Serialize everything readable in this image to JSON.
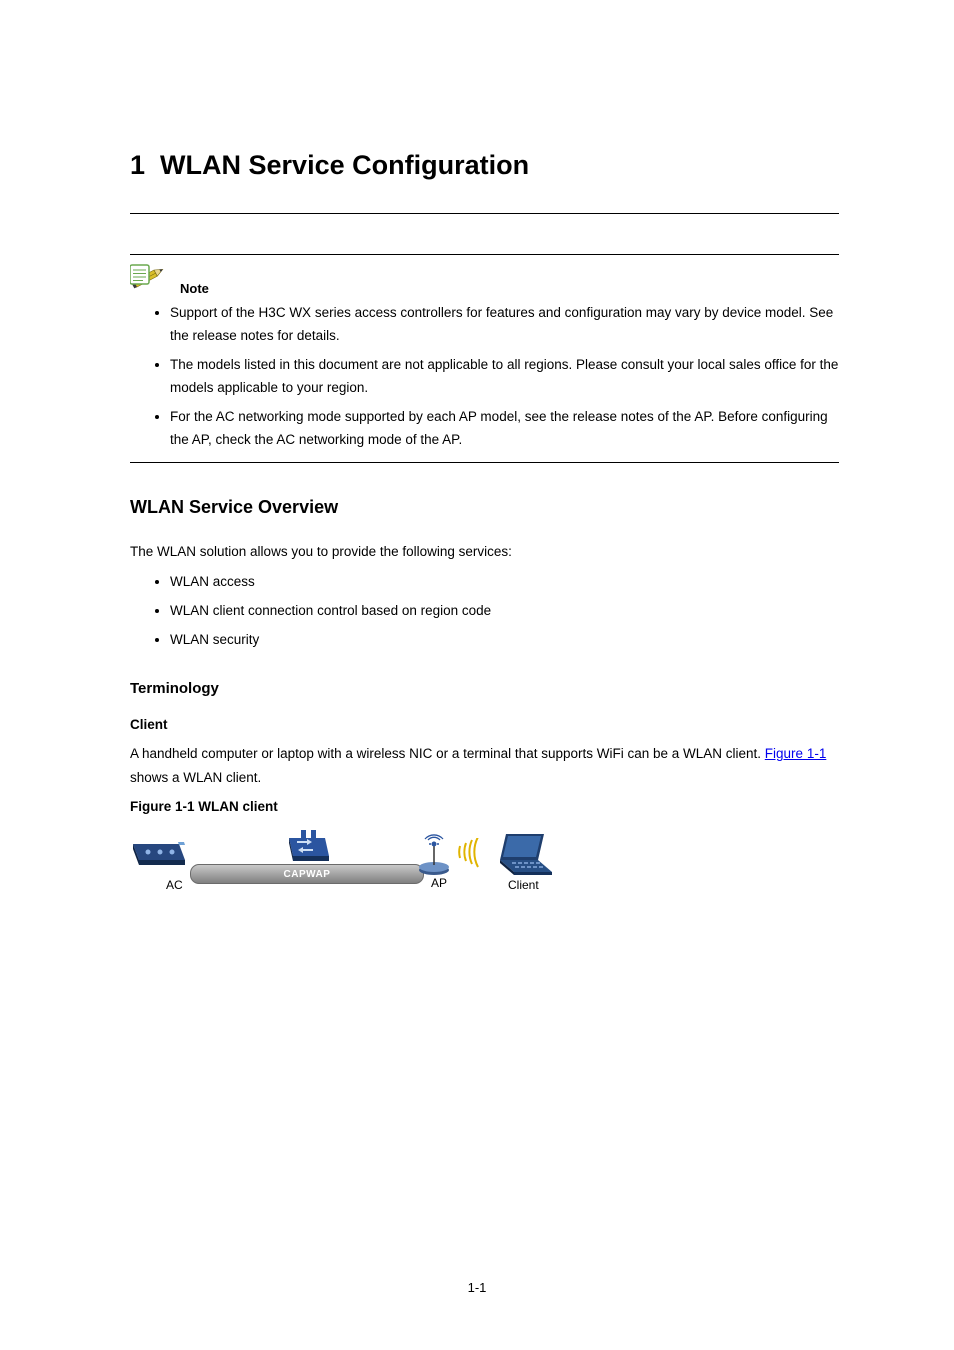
{
  "chapter": {
    "num": "1",
    "title": "WLAN Service Configuration"
  },
  "note": {
    "label": "Note",
    "items": [
      "Support of the H3C WX series access controllers for features and configuration may vary by device model. See the release notes for details.",
      "The models listed in this document are not applicable to all regions. Please consult your local sales office for the models applicable to your region.",
      "For the AC networking mode supported by each AP model, see the release notes of the AP. Before configuring the AP, check the AC networking mode of the AP."
    ]
  },
  "overview": {
    "heading": "WLAN Service Overview",
    "para": "The WLAN solution allows you to provide the following services:",
    "items": [
      "WLAN access",
      "WLAN client connection control based on region code",
      "WLAN security"
    ]
  },
  "terminology": {
    "heading": "Terminology",
    "client": {
      "heading": "Client",
      "para_before_link": "A handheld computer or laptop with a wireless NIC or a terminal that supports WiFi can be a WLAN client. ",
      "link_text": "Figure 1-1",
      "para_after_link": " shows a WLAN client."
    }
  },
  "figure": {
    "label_num": "Figure 1-1",
    "label_text": "WLAN client",
    "tunnel_label": "CAPWAP",
    "ac_label": "AC",
    "ap_label": "AP",
    "client_label": "Client"
  },
  "page_number": "1-1"
}
